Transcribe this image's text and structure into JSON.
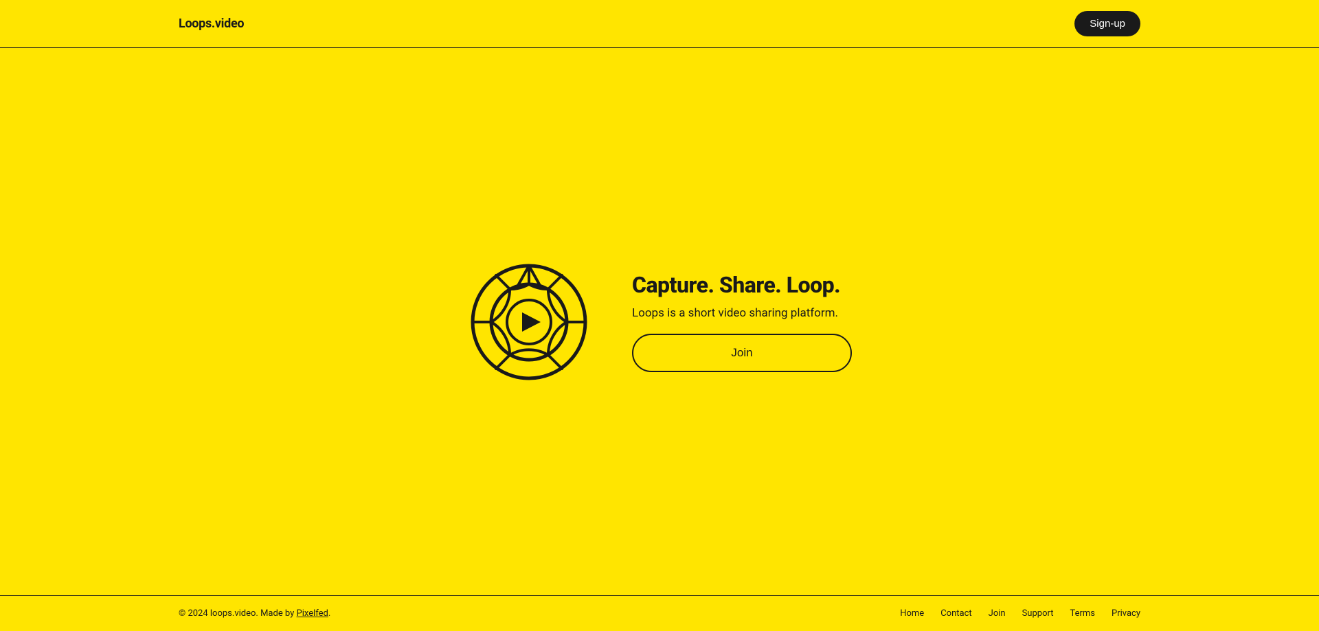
{
  "header": {
    "logo": "Loops.video",
    "signup_label": "Sign-up"
  },
  "hero": {
    "title": "Capture. Share. Loop.",
    "subtitle": "Loops is a short video sharing platform.",
    "join_label": "Join"
  },
  "footer": {
    "copyright": "© 2024 loops.video. Made by ",
    "made_by_link_text": "Pixelfed",
    "made_by_link_suffix": ".",
    "links": [
      {
        "label": "Home",
        "href": "#"
      },
      {
        "label": "Contact",
        "href": "#"
      },
      {
        "label": "Join",
        "href": "#"
      },
      {
        "label": "Support",
        "href": "#"
      },
      {
        "label": "Terms",
        "href": "#"
      },
      {
        "label": "Privacy",
        "href": "#"
      }
    ]
  }
}
